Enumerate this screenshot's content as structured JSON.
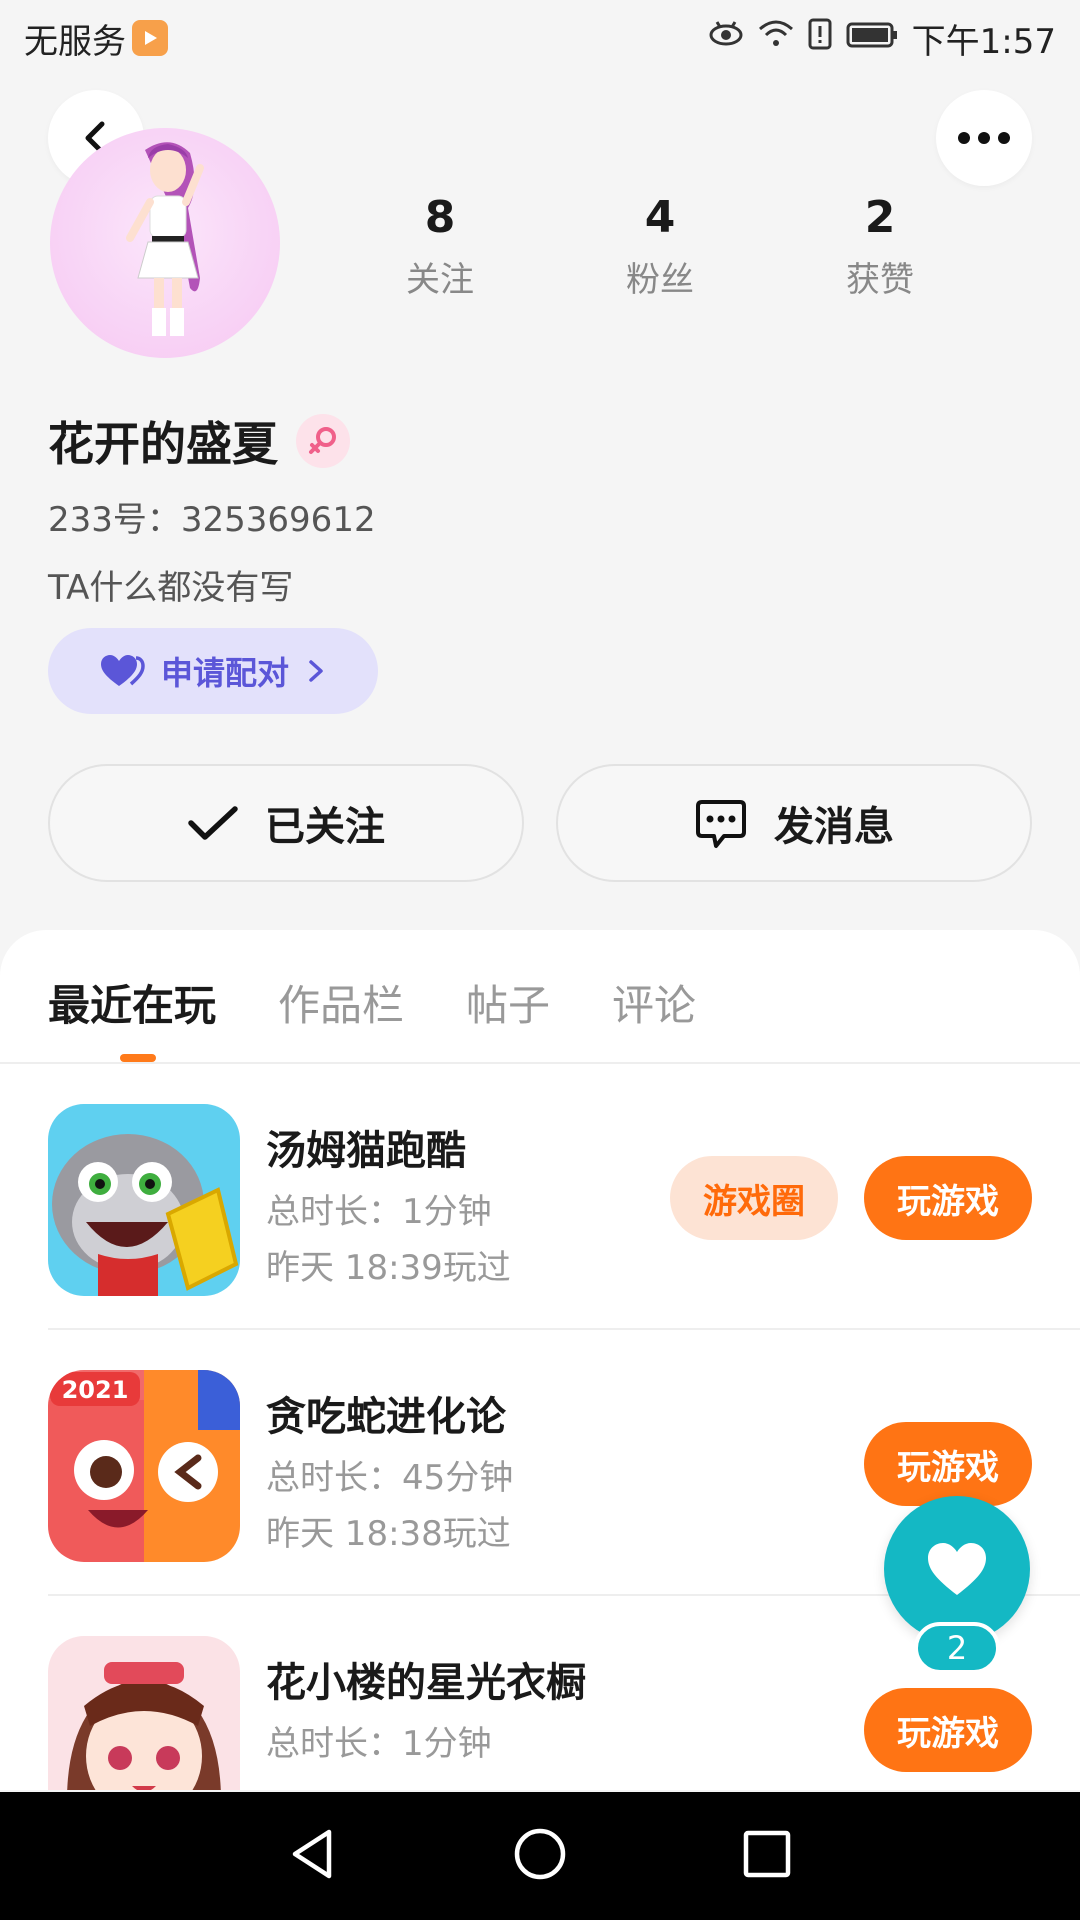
{
  "status_bar": {
    "carrier": "无服务",
    "time": "下午1:57"
  },
  "profile": {
    "stats": [
      {
        "value": "8",
        "label": "关注"
      },
      {
        "value": "4",
        "label": "粉丝"
      },
      {
        "value": "2",
        "label": "获赞"
      }
    ],
    "name": "花开的盛夏",
    "id_text": "233号：325369612",
    "bio": "TA什么都没有写",
    "pair_label": "申请配对",
    "follow_label": "已关注",
    "message_label": "发消息"
  },
  "tabs": [
    {
      "label": "最近在玩",
      "active": true
    },
    {
      "label": "作品栏",
      "active": false
    },
    {
      "label": "帖子",
      "active": false
    },
    {
      "label": "评论",
      "active": false
    }
  ],
  "games": [
    {
      "name": "汤姆猫跑酷",
      "duration": "总时长：1分钟",
      "last_played": "昨天 18:39玩过",
      "circle_label": "游戏圈",
      "play_label": "玩游戏"
    },
    {
      "name": "贪吃蛇进化论",
      "duration": "总时长：45分钟",
      "last_played": "昨天 18:38玩过",
      "play_label": "玩游戏",
      "icon_badge": "2021"
    },
    {
      "name": "花小楼的星光衣橱",
      "duration": "总时长：1分钟",
      "last_played": "",
      "play_label": "玩游戏"
    }
  ],
  "fab": {
    "count": "2"
  },
  "colors": {
    "accent": "#ff7414",
    "pair": "#5b56d8",
    "fab": "#14b8c4"
  }
}
